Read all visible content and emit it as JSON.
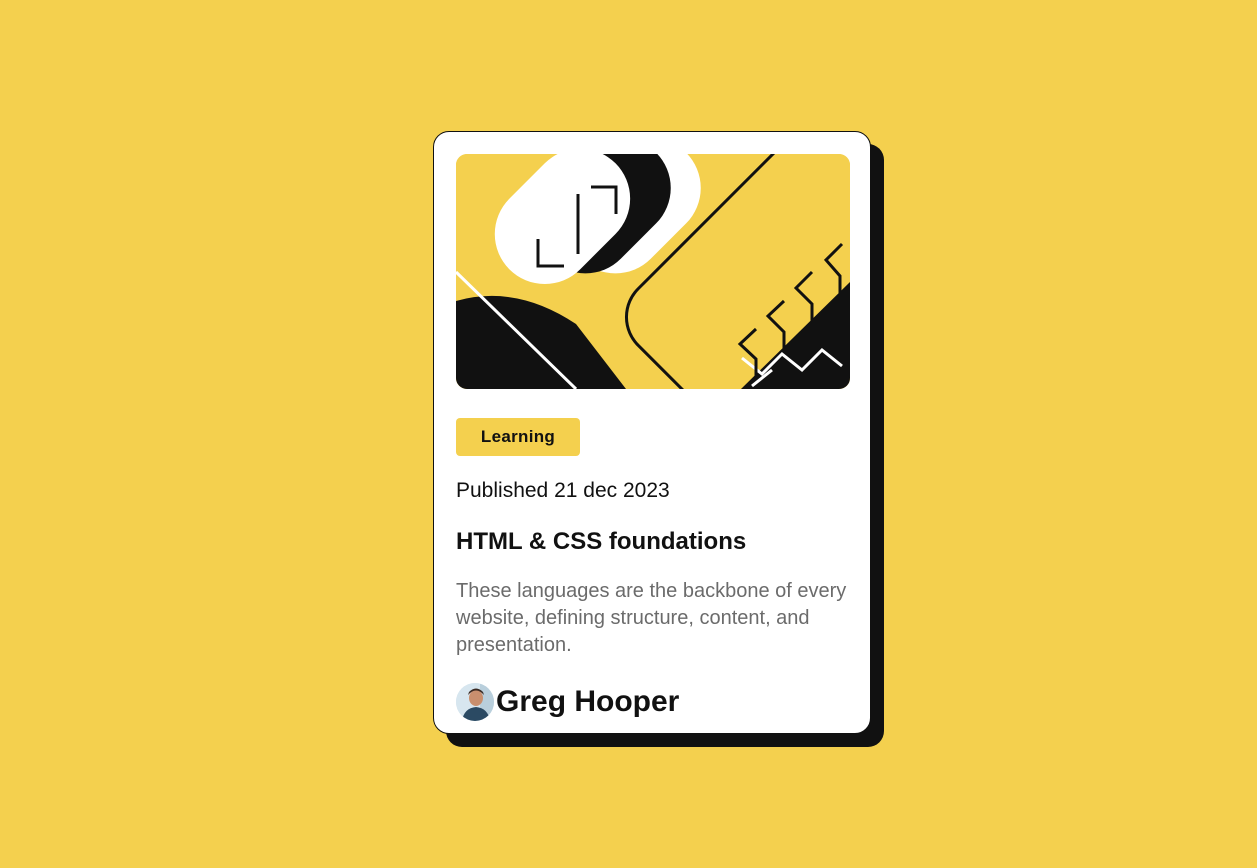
{
  "colors": {
    "background": "#f4d04e",
    "card": "#ffffff",
    "ink": "#111111",
    "muted_text": "#6b6b6b",
    "tag": "#f4d04e"
  },
  "card": {
    "illustration_icon": "abstract-geometric-illustration",
    "tag_label": "Learning",
    "published": "Published 21 dec 2023",
    "title": "HTML & CSS foundations",
    "description": "These languages are the backbone of every website, defining structure, content, and presentation.",
    "author": {
      "avatar_icon": "author-avatar",
      "name": "Greg Hooper"
    }
  }
}
